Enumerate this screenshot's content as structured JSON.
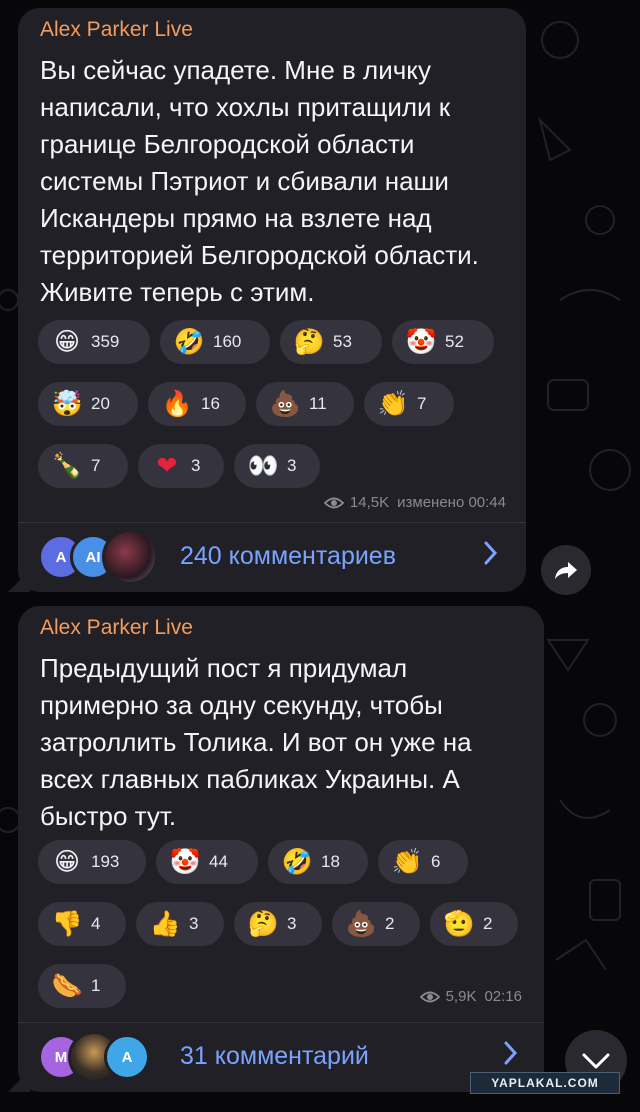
{
  "colors": {
    "author": "#f49c5d",
    "link": "#7aa3ff",
    "bubble": "#212026",
    "pill": "#35333d"
  },
  "post1": {
    "author": "Alex Parker Live",
    "text": "Вы сейчас упадете. Мне в личку написали, что хохлы притащили к границе Белгородской области системы Пэтриот и сбивали наши Искандеры прямо на взлете над территорией Белгородской области. Живите теперь с этим.",
    "reactions": [
      {
        "emoji": "😁",
        "icon": "grinning-face-icon",
        "count": "359"
      },
      {
        "emoji": "🤣",
        "icon": "rofl-face-icon",
        "count": "160"
      },
      {
        "emoji": "🤔",
        "icon": "thinking-face-icon",
        "count": "53"
      },
      {
        "emoji": "🤡",
        "icon": "clown-face-icon",
        "count": "52"
      },
      {
        "emoji": "🤯",
        "icon": "exploding-head-icon",
        "count": "20"
      },
      {
        "emoji": "🔥",
        "icon": "fire-icon",
        "count": "16"
      },
      {
        "emoji": "💩",
        "icon": "poop-icon",
        "count": "11"
      },
      {
        "emoji": "👏",
        "icon": "clapping-hands-icon",
        "count": "7"
      },
      {
        "emoji": "🍾",
        "icon": "champagne-icon",
        "count": "7"
      },
      {
        "emoji": "❤",
        "icon": "heart-icon",
        "count": "3"
      },
      {
        "emoji": "👀",
        "icon": "eyes-icon",
        "count": "3"
      }
    ],
    "views": "14,5K",
    "edited": "изменено 00:44",
    "comments_label": "240 комментариев",
    "avatars": [
      "A",
      "AI",
      ""
    ]
  },
  "post2": {
    "author": "Alex Parker Live",
    "text": "Предыдущий пост я придумал примерно за одну секунду, чтобы затроллить Толика. И вот он уже на всех главных пабликах Украины. А быстро тут.",
    "reactions": [
      {
        "emoji": "😁",
        "icon": "grinning-face-icon",
        "count": "193"
      },
      {
        "emoji": "🤡",
        "icon": "clown-face-icon",
        "count": "44"
      },
      {
        "emoji": "🤣",
        "icon": "rofl-face-icon",
        "count": "18"
      },
      {
        "emoji": "👏",
        "icon": "clapping-hands-icon",
        "count": "6"
      },
      {
        "emoji": "👎",
        "icon": "thumbs-down-icon",
        "count": "4"
      },
      {
        "emoji": "👍",
        "icon": "thumbs-up-icon",
        "count": "3"
      },
      {
        "emoji": "🤔",
        "icon": "thinking-face-icon",
        "count": "3"
      },
      {
        "emoji": "💩",
        "icon": "poop-icon",
        "count": "2"
      },
      {
        "emoji": "🫡",
        "icon": "pointing-hand-icon",
        "count": "2"
      },
      {
        "emoji": "🌭",
        "icon": "hotdog-icon",
        "count": "1"
      }
    ],
    "views": "5,9K",
    "time": "02:16",
    "comments_label": "31 комментарий",
    "avatars": [
      "M",
      "",
      "A"
    ]
  },
  "watermark": "YAPLAKAL.COM"
}
